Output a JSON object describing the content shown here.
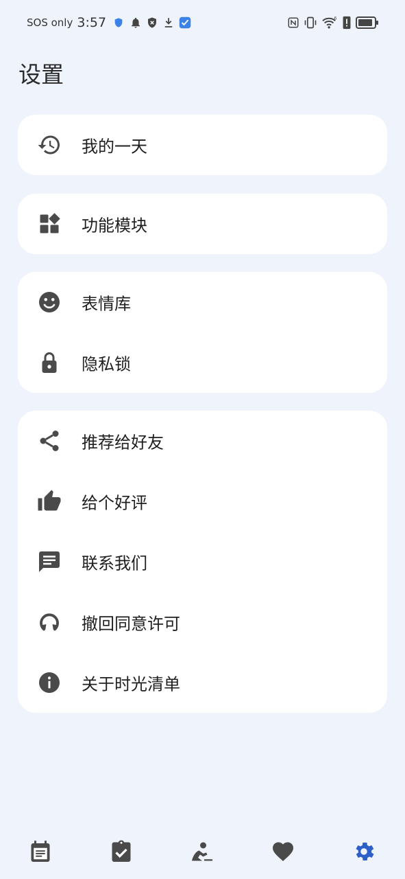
{
  "status_bar": {
    "sos": "SOS only",
    "time": "3:57",
    "left_icons": [
      "shield-icon",
      "bell-icon",
      "block-icon",
      "download-icon",
      "app-badge-icon"
    ],
    "right_icons": [
      "nfc-icon",
      "vibrate-icon",
      "wifi-6-icon",
      "alert-icon",
      "battery-icon"
    ]
  },
  "page": {
    "title": "设置"
  },
  "settings": {
    "my_day": {
      "label": "我的一天",
      "icon": "history-icon"
    },
    "modules": {
      "label": "功能模块",
      "icon": "widgets-icon"
    },
    "emoji_library": {
      "label": "表情库",
      "icon": "smiley-icon"
    },
    "privacy_lock": {
      "label": "隐私锁",
      "icon": "lock-icon"
    },
    "share": {
      "label": "推荐给好友",
      "icon": "share-icon"
    },
    "rate": {
      "label": "给个好评",
      "icon": "thumb-up-icon"
    },
    "contact": {
      "label": "联系我们",
      "icon": "message-icon"
    },
    "revoke_consent": {
      "label": "撤回同意许可",
      "icon": "restart-icon"
    },
    "about": {
      "label": "关于时光清单",
      "icon": "info-icon"
    }
  },
  "bottom_nav": {
    "items": [
      "calendar-note-icon",
      "clipboard-check-icon",
      "reading-person-icon",
      "heart-icon",
      "gear-icon"
    ],
    "active": "gear-icon"
  },
  "colors": {
    "background": "#eff4fc",
    "card": "#ffffff",
    "icon": "#4a4a4a",
    "accent": "#2c5fc8",
    "app_badge": "#3b82e8"
  }
}
